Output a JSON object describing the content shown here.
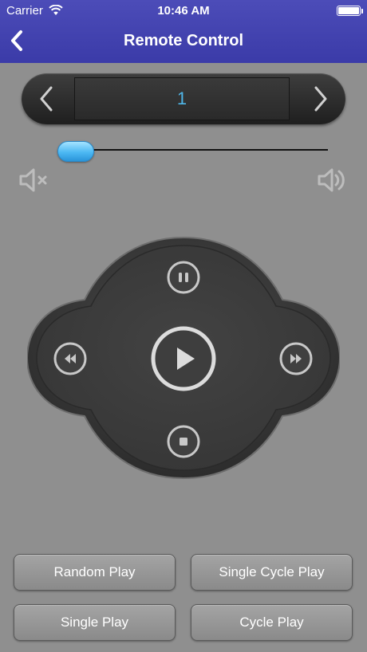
{
  "status_bar": {
    "carrier": "Carrier",
    "time": "10:46 AM"
  },
  "nav": {
    "title": "Remote Control"
  },
  "selector": {
    "value": "1"
  },
  "volume": {
    "level": 0.07
  },
  "modes": {
    "random": "Random Play",
    "single_cycle": "Single Cycle Play",
    "single": "Single Play",
    "cycle": "Cycle Play"
  },
  "icons": [
    "wifi-icon",
    "battery-icon",
    "back-icon",
    "prev-icon",
    "next-icon",
    "mute-icon",
    "volume-icon",
    "pause-icon",
    "rewind-icon",
    "play-icon",
    "fast-forward-icon",
    "stop-icon"
  ],
  "colors": {
    "header": "#3b3ba8",
    "accent": "#4fb6e8",
    "background": "#8f8f8f",
    "pad": "#3a3a3a"
  }
}
